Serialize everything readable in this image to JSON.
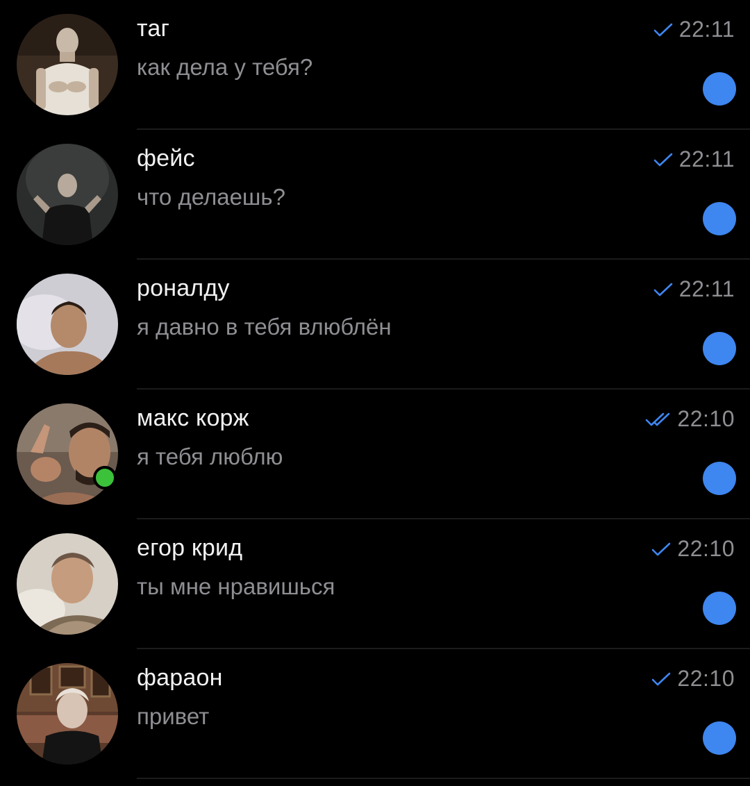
{
  "colors": {
    "background": "#000000",
    "accent": "#3e86f0",
    "check": "#3e86f0",
    "secondary_text": "#8e8e93",
    "online": "#3cc13b"
  },
  "chats": [
    {
      "name": "таг",
      "preview": "как дела у тебя?",
      "time": "22:11",
      "read_status": "single-check-icon",
      "online": false,
      "unread": true
    },
    {
      "name": "фейс",
      "preview": "что делаешь?",
      "time": "22:11",
      "read_status": "single-check-icon",
      "online": false,
      "unread": true
    },
    {
      "name": "роналду",
      "preview": "я давно в тебя влюблён",
      "time": "22:11",
      "read_status": "single-check-icon",
      "online": false,
      "unread": true
    },
    {
      "name": "макс корж",
      "preview": "я тебя люблю",
      "time": "22:10",
      "read_status": "double-check-icon",
      "online": true,
      "unread": true
    },
    {
      "name": "егор крид",
      "preview": "ты мне нравишься",
      "time": "22:10",
      "read_status": "single-check-icon",
      "online": false,
      "unread": true
    },
    {
      "name": "фараон",
      "preview": "привет",
      "time": "22:10",
      "read_status": "single-check-icon",
      "online": false,
      "unread": true
    }
  ]
}
